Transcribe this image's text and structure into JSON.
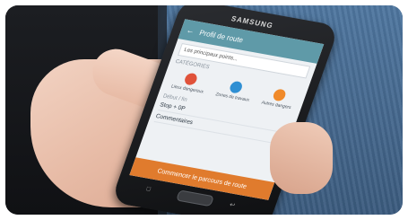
{
  "phone": {
    "brand": "SAMSUNG",
    "app_title": "Profil de route",
    "search_text": "Les principaux points...",
    "section_label": "CATÉGORIES",
    "categories": [
      {
        "label": "Lieux dangereux",
        "color": "#e0523a"
      },
      {
        "label": "Zones de travaux",
        "color": "#2f8fd3"
      },
      {
        "label": "Autres dangers",
        "color": "#f08a2a"
      }
    ],
    "section2_label": "Début / fin",
    "row1": "Stop + 0P",
    "row2": "Commentaires",
    "cta_label": "Commencer le parcours de route"
  }
}
